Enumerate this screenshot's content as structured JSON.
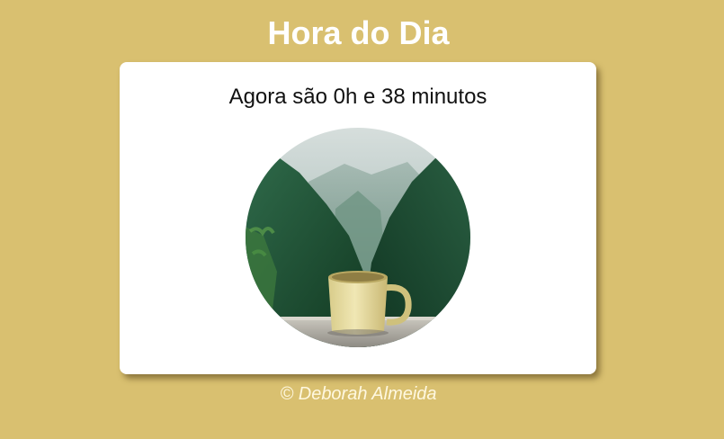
{
  "header": {
    "title": "Hora do Dia"
  },
  "card": {
    "time_message": "Agora são 0h e 38 minutos",
    "image_alt": "Xícara de café com floresta e neblina ao fundo"
  },
  "footer": {
    "copyright": "© Deborah Almeida"
  },
  "colors": {
    "background": "#d9c070",
    "card": "#ffffff",
    "title": "#ffffff"
  }
}
